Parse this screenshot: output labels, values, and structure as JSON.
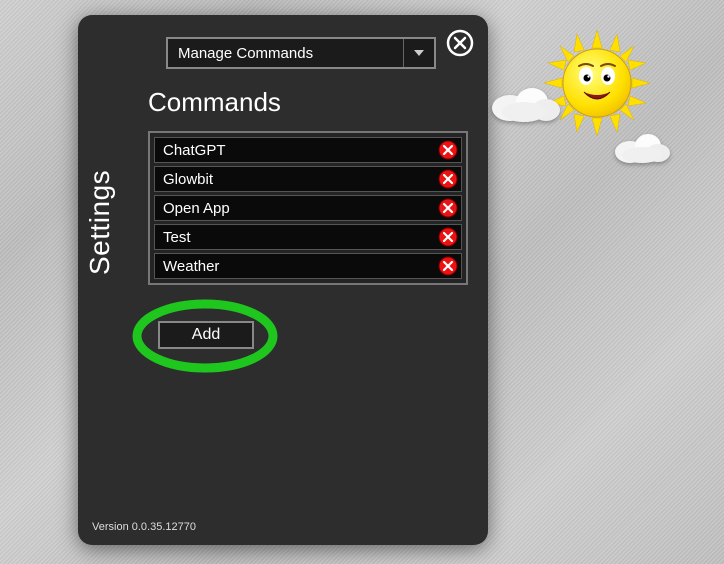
{
  "sidebar_label": "Settings",
  "dropdown": {
    "selected": "Manage Commands"
  },
  "section_title": "Commands",
  "commands": [
    {
      "name": "ChatGPT"
    },
    {
      "name": "Glowbit"
    },
    {
      "name": "Open App"
    },
    {
      "name": "Test"
    },
    {
      "name": "Weather"
    }
  ],
  "add_button_label": "Add",
  "version_text": "Version 0.0.35.12770",
  "highlight_color": "#1ec61e"
}
